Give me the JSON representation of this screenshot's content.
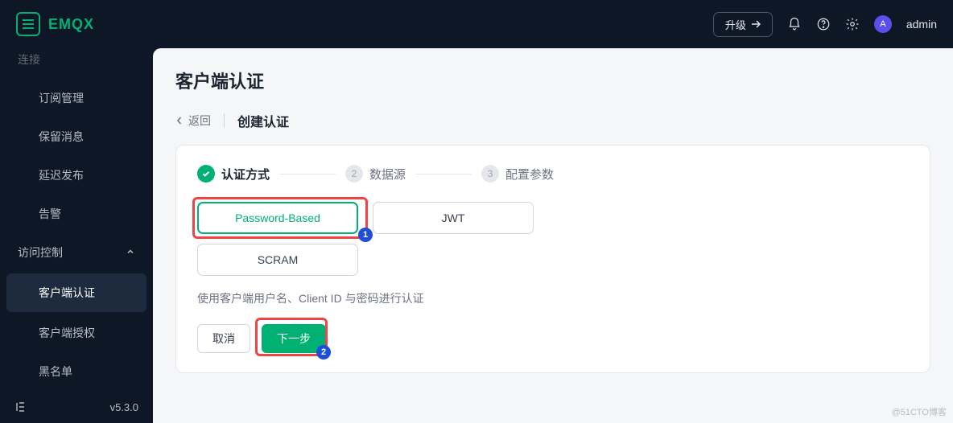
{
  "brand": "EMQX",
  "header": {
    "upgrade": "升级",
    "user_initial": "A",
    "username": "admin"
  },
  "sidebar": {
    "items": [
      "订阅管理",
      "保留消息",
      "延迟发布",
      "告警"
    ],
    "top_cut": "连接",
    "access_label": "访问控制",
    "sub": [
      "客户端认证",
      "客户端授权",
      "黑名单"
    ],
    "version": "v5.3.0"
  },
  "page": {
    "title": "客户端认证",
    "back": "返回",
    "crumb": "创建认证"
  },
  "steps": [
    "认证方式",
    "数据源",
    "配置参数"
  ],
  "options": {
    "password": "Password-Based",
    "jwt": "JWT",
    "scram": "SCRAM"
  },
  "desc": "使用客户端用户名、Client ID 与密码进行认证",
  "buttons": {
    "cancel": "取消",
    "next": "下一步"
  },
  "annotations": {
    "a1": "1",
    "a2": "2"
  },
  "watermark": "@51CTO博客"
}
